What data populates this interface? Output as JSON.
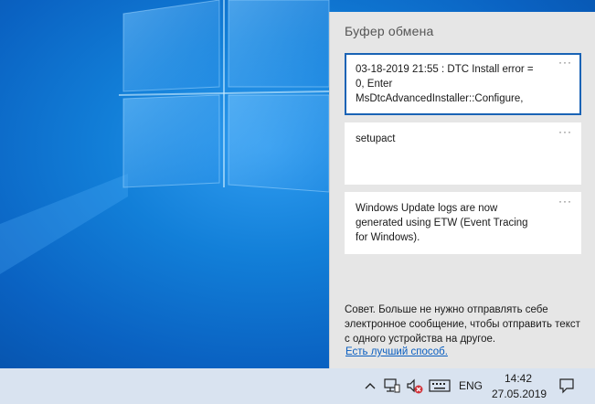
{
  "clipboard": {
    "title": "Буфер обмена",
    "items": [
      {
        "text": "03-18-2019 21:55 : DTC Install error = 0, Enter MsDtcAdvancedInstaller::Configure,",
        "more": "···"
      },
      {
        "text": "setupact",
        "more": "···"
      },
      {
        "text": "Windows Update logs are now generated using ETW (Event Tracing for Windows).",
        "more": "···"
      }
    ],
    "tip": "Совет. Больше не нужно отправлять себе электронное сообщение, чтобы отправить текст с одного устройства на другое.",
    "tip_link": "Есть лучший способ."
  },
  "taskbar": {
    "language": "ENG",
    "time": "14:42",
    "date": "27.05.2019",
    "icons": [
      "chevron-up-icon",
      "network-icon",
      "volume-muted-icon",
      "keyboard-icon",
      "notification-icon"
    ]
  },
  "colors": {
    "accent": "#1a63b5",
    "link": "#0a5ec0",
    "panel": "#e6e6e6",
    "taskbar": "#d9e3f0"
  }
}
